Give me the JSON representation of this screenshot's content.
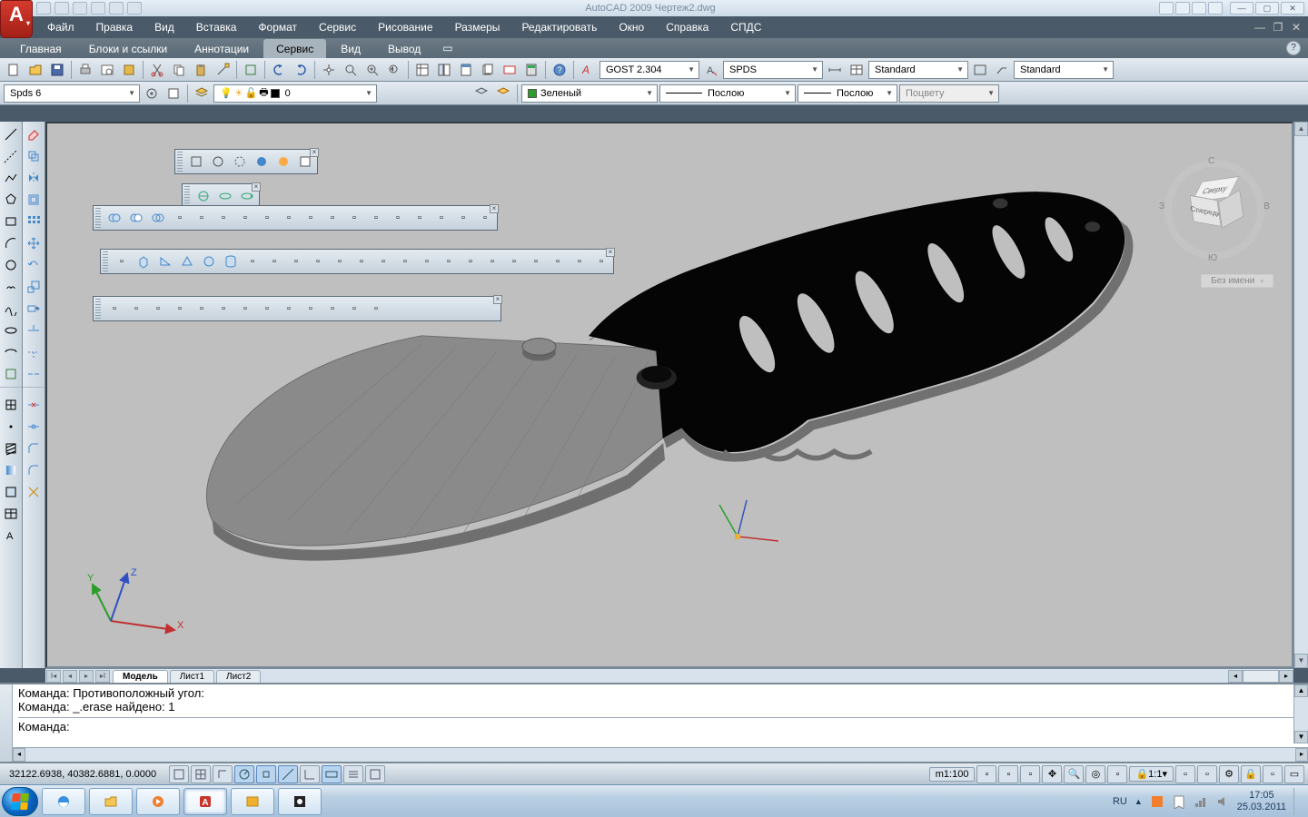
{
  "window": {
    "title": "AutoCAD 2009 Чертеж2.dwg"
  },
  "menu": [
    "Файл",
    "Правка",
    "Вид",
    "Вставка",
    "Формат",
    "Сервис",
    "Рисование",
    "Размеры",
    "Редактировать",
    "Окно",
    "Справка",
    "СПДС"
  ],
  "ribbon_tabs": {
    "items": [
      "Главная",
      "Блоки и ссылки",
      "Аннотации",
      "Сервис",
      "Вид",
      "Вывод"
    ],
    "active_index": 3
  },
  "toolbar1": {
    "text_style_combo": "GOST 2.304",
    "dim_style_combo": "SPDS",
    "table_style_combo": "Standard",
    "ml_style_combo": "Standard"
  },
  "toolbar2": {
    "left_combo": "Spds 6",
    "layer_combo": "0",
    "color_combo": "Зеленый",
    "linetype_combo": "Послою",
    "lineweight_combo": "Послою",
    "plotstyle_combo": "Поцвету"
  },
  "layout_tabs": {
    "items": [
      "Модель",
      "Лист1",
      "Лист2"
    ],
    "active_index": 0
  },
  "viewcube": {
    "top": "Сверху",
    "front": "Спереди",
    "drawing_name": "Без имени",
    "north": "С",
    "south": "Ю",
    "east": "В",
    "west": "З"
  },
  "ucs_labels": {
    "x": "X",
    "y": "Y",
    "z": "Z"
  },
  "command_window": {
    "line1": "Команда: Противоположный угол:",
    "line2": "Команда: _.erase найдено: 1",
    "prompt": "Команда:"
  },
  "status_bar": {
    "coords": "32122.6938, 40382.6881, 0.0000",
    "scale": "m1:100",
    "annoscale": "1:1"
  },
  "taskbar": {
    "lang": "RU",
    "time": "17:05",
    "date": "25.03.2011"
  }
}
